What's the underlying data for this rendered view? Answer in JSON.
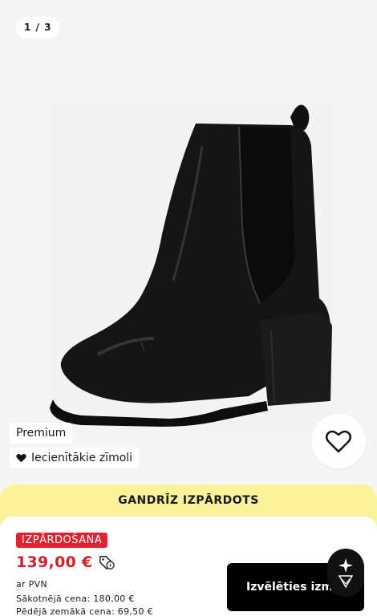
{
  "gallery": {
    "pager": "1 / 3",
    "tags": {
      "premium": "Premium",
      "brands": "Iecienītākie zīmoli"
    },
    "icons": {
      "wishlist": "heart-outline-icon",
      "brands": "heart-filled-icon"
    }
  },
  "sheet": {
    "banner": "GANDRĪZ IZPĀRDOTS",
    "sale_badge": "IZPĀRDOŠANA",
    "price": "139,00 €",
    "vat": "ar PVN",
    "original_price": "Sākotnējā cena: 180,00 €",
    "lowest_price": "Pēdējā zemākā cena: 69,50 €",
    "select_size": "Izvēlēties izmēru"
  },
  "colors": {
    "sale": "#e0232e",
    "banner": "#fbf39a",
    "button": "#000000"
  }
}
